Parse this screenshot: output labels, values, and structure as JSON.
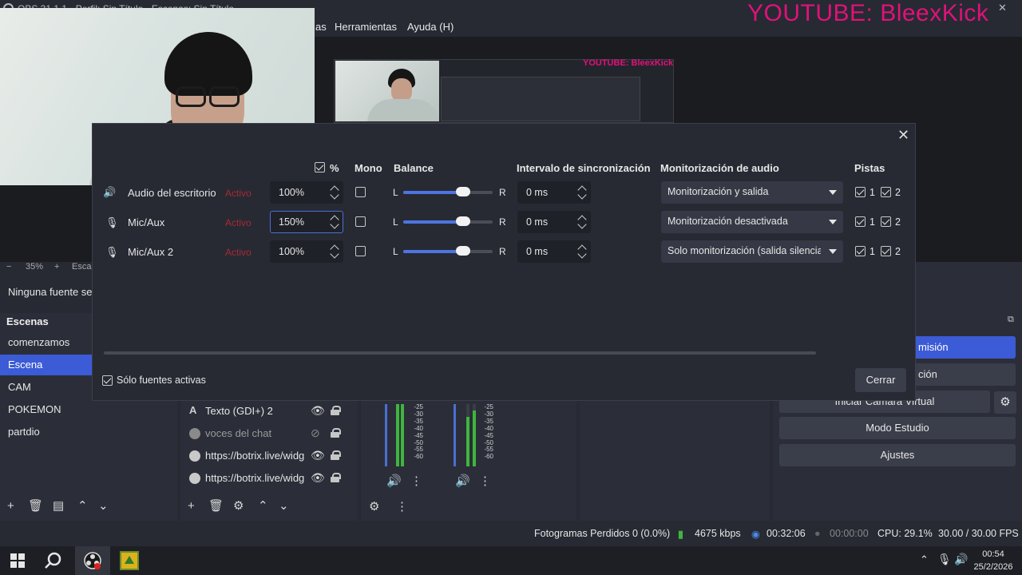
{
  "window": {
    "title": "OBS 31.1.1 - Perfil: Sin Título - Escenas: Sin Título",
    "menu": [
      "Herramientas",
      "Ayuda (H)"
    ]
  },
  "overlay": {
    "youtube_banner": "YOUTUBE: BleexKick",
    "nested_banner": "YOUTUBE: BleexKick"
  },
  "preview": {
    "zoom": "35%",
    "scale_label": "Escal",
    "no_source": "Ninguna fuente sel"
  },
  "scenes": {
    "title": "Escenas",
    "items": [
      {
        "label": "comenzamos",
        "selected": false
      },
      {
        "label": "Escena",
        "selected": true
      },
      {
        "label": "CAM",
        "selected": false
      },
      {
        "label": "POKEMON",
        "selected": false
      },
      {
        "label": "partdio",
        "selected": false
      }
    ]
  },
  "sources": {
    "items": [
      {
        "label": "Texto (GDI+) 2",
        "icon": "text-icon",
        "visible": true
      },
      {
        "label": "voces del chat",
        "icon": "browser-icon",
        "visible": false
      },
      {
        "label": "https://botrix.live/widg",
        "icon": "browser-icon",
        "visible": true
      },
      {
        "label": "https://botrix.live/widg",
        "icon": "browser-icon",
        "visible": true
      }
    ]
  },
  "mixer": {
    "scale_labels": [
      "-25",
      "-30",
      "-35",
      "-40",
      "-45",
      "-50",
      "-55",
      "-60"
    ]
  },
  "controls": {
    "start_stream": "misión",
    "start_record": "ción",
    "virtual_cam": "Iniciar Cámara Virtual",
    "studio_mode": "Modo Estudio",
    "settings": "Ajustes"
  },
  "status": {
    "dropped": "Fotogramas Perdidos 0 (0.0%)",
    "bitrate": "4675 kbps",
    "stream_time": "00:32:06",
    "record_time": "00:00:00",
    "cpu": "CPU: 29.1%",
    "fps": "30.00 / 30.00 FPS"
  },
  "dialog": {
    "headers": {
      "percent": "%",
      "mono": "Mono",
      "balance": "Balance",
      "sync": "Intervalo de sincronización",
      "monitoring": "Monitorización de audio",
      "tracks": "Pistas"
    },
    "rows": [
      {
        "icon": "speaker-icon",
        "name": "Audio del escritorio",
        "status": "Activo",
        "volume": "100%",
        "mono": false,
        "balance_left": "L",
        "balance_right": "R",
        "balance": 0.5,
        "sync": "0 ms",
        "monitoring": "Monitorización y salida",
        "tracks": [
          "1",
          "2"
        ]
      },
      {
        "icon": "mic-icon",
        "name": "Mic/Aux",
        "status": "Activo",
        "volume": "150%",
        "mono": false,
        "balance_left": "L",
        "balance_right": "R",
        "balance": 0.5,
        "sync": "0 ms",
        "monitoring": "Monitorización desactivada",
        "tracks": [
          "1",
          "2"
        ]
      },
      {
        "icon": "mic-icon",
        "name": "Mic/Aux 2",
        "status": "Activo",
        "volume": "100%",
        "mono": false,
        "balance_left": "L",
        "balance_right": "R",
        "balance": 0.5,
        "sync": "0 ms",
        "monitoring": "Solo monitorización (salida silencia",
        "tracks": [
          "1",
          "2"
        ]
      }
    ],
    "only_active": "Sólo fuentes activas",
    "close_button": "Cerrar"
  },
  "taskbar": {
    "time": "00:54",
    "date": "25/2/2026"
  }
}
